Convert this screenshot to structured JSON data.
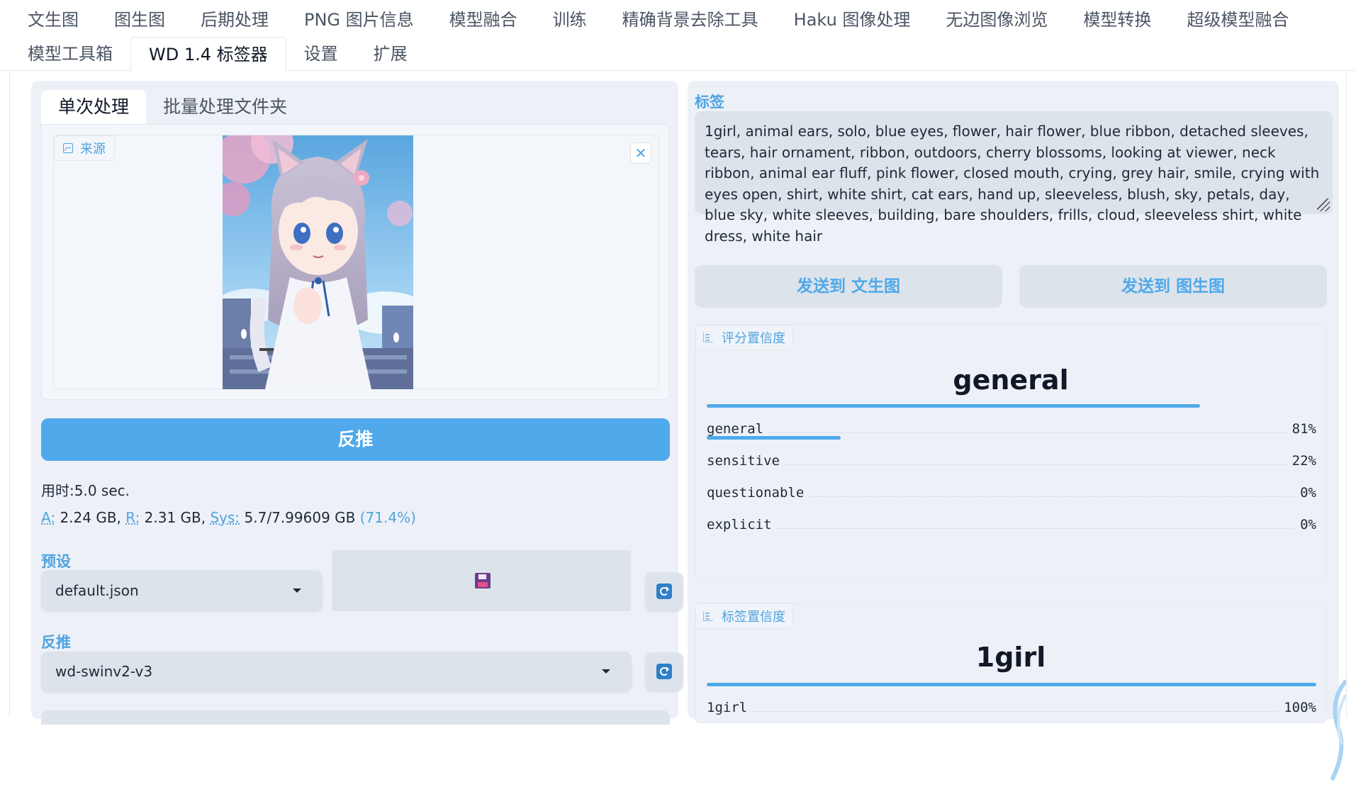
{
  "top_tabs_row1": [
    "文生图",
    "图生图",
    "后期处理",
    "PNG 图片信息",
    "模型融合",
    "训练",
    "精确背景去除工具",
    "Haku 图像处理",
    "无边图像浏览",
    "模型转换",
    "超级模型融合"
  ],
  "top_tabs_row2": [
    "模型工具箱",
    "WD 1.4 标签器",
    "设置",
    "扩展"
  ],
  "active_top_tab": "WD 1.4 标签器",
  "left": {
    "subtabs": [
      "单次处理",
      "批量处理文件夹"
    ],
    "active_subtab": "单次处理",
    "source_label": "来源",
    "close_glyph": "✕",
    "interrogate_label": "反推",
    "time_text": "用时:5.0 sec.",
    "mem": {
      "a_label": "A:",
      "a_value": "2.24 GB,",
      "r_label": "R:",
      "r_value": "2.31 GB,",
      "sys_label": "Sys:",
      "sys_value": "5.7/7.99609 GB",
      "pct": "(71.4%)"
    },
    "preset_label": "预设",
    "preset_value": "default.json",
    "interrogator_label": "反推",
    "interrogator_value": "wd-swinv2-v3"
  },
  "right": {
    "tags_label": "标签",
    "tags_text": "1girl, animal ears, solo, blue eyes, flower, hair flower, blue ribbon, detached sleeves, tears, hair ornament, ribbon, outdoors, cherry blossoms, looking at viewer, neck ribbon, animal ear fluff, pink flower, closed mouth, crying, grey hair, smile, crying with eyes open, shirt, white shirt, cat ears, hand up, sleeveless, blush, sky, petals, day, blue sky, white sleeves, building, bare shoulders, frills, cloud, sleeveless shirt, white dress, white hair",
    "send_txt2img": "发送到 文生图",
    "send_img2img": "发送到 图生图",
    "rating_box_label": "评分置信度",
    "rating_top": "general",
    "ratings": [
      {
        "name": "general",
        "pct": "81%",
        "value": 0.81
      },
      {
        "name": "sensitive",
        "pct": "22%",
        "value": 0.22
      },
      {
        "name": "questionable",
        "pct": "0%",
        "value": 0
      },
      {
        "name": "explicit",
        "pct": "0%",
        "value": 0
      }
    ],
    "tag_box_label": "标签置信度",
    "tag_top": "1girl",
    "tags": [
      {
        "name": "1girl",
        "pct": "100%",
        "value": 1.0
      }
    ]
  },
  "colors": {
    "accent": "#4fa9ea",
    "panel": "#edf1f7",
    "field": "#dde3ea"
  }
}
